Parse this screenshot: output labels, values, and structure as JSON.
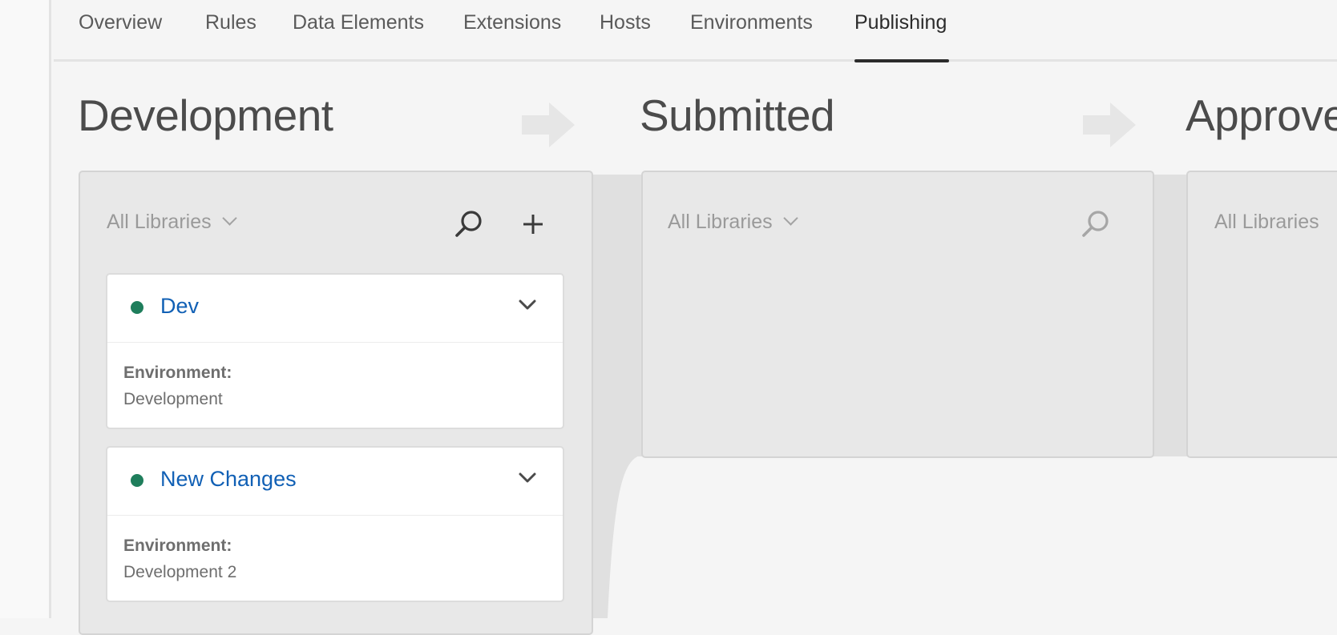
{
  "nav": {
    "tabs": [
      {
        "label": "Overview"
      },
      {
        "label": "Rules"
      },
      {
        "label": "Data Elements"
      },
      {
        "label": "Extensions"
      },
      {
        "label": "Hosts"
      },
      {
        "label": "Environments"
      },
      {
        "label": "Publishing"
      }
    ],
    "active_tab": "Publishing"
  },
  "columns": {
    "development": {
      "title": "Development",
      "filter_label": "All Libraries",
      "libraries": [
        {
          "name": "Dev",
          "environment_label": "Environment:",
          "environment": "Development",
          "status_color": "#1f7e5c"
        },
        {
          "name": "New Changes",
          "environment_label": "Environment:",
          "environment": "Development 2",
          "status_color": "#1f7e5c"
        }
      ]
    },
    "submitted": {
      "title": "Submitted",
      "filter_label": "All Libraries"
    },
    "approved": {
      "title": "Approve",
      "filter_label": "All Libraries"
    }
  },
  "icons": {
    "search": "search-icon",
    "add": "plus-icon",
    "flow_arrow": "arrow-right-icon"
  },
  "colors": {
    "link": "#1160b5",
    "status_ok": "#1f7e5c",
    "panel_bg": "#e8e8e8"
  }
}
